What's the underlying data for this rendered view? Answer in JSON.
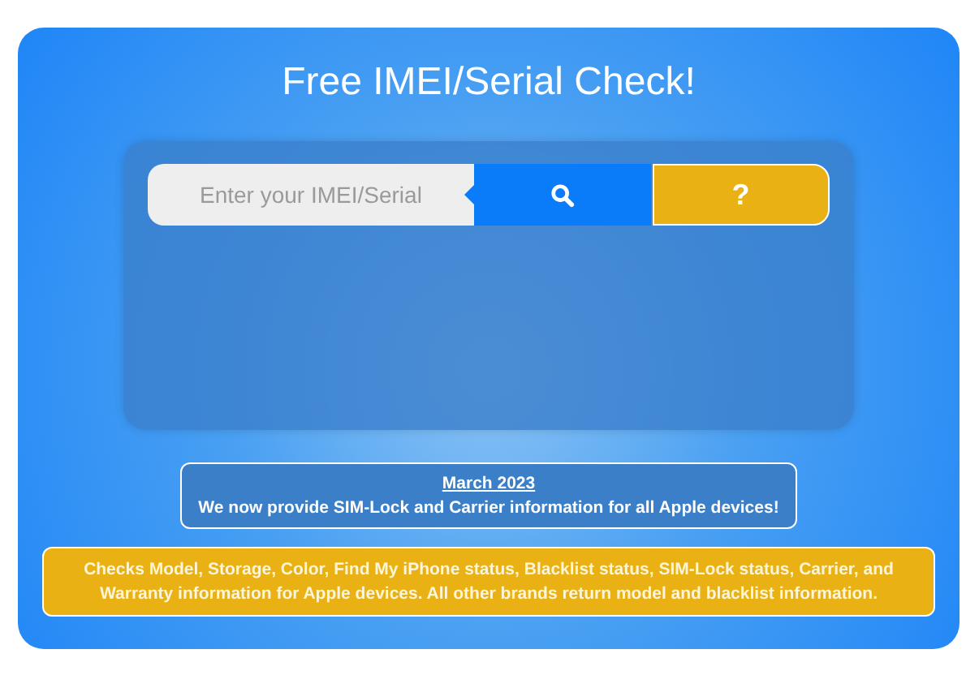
{
  "title": "Free IMEI/Serial Check!",
  "search": {
    "placeholder": "Enter your IMEI/Serial"
  },
  "help_button": {
    "label": "?"
  },
  "notice": {
    "date": "March 2023",
    "text": "We now provide SIM-Lock and Carrier information for all Apple devices!"
  },
  "info": "Checks Model, Storage, Color, Find My iPhone status, Blacklist status, SIM-Lock status, Carrier, and Warranty information for Apple devices. All other brands return model and blacklist information."
}
